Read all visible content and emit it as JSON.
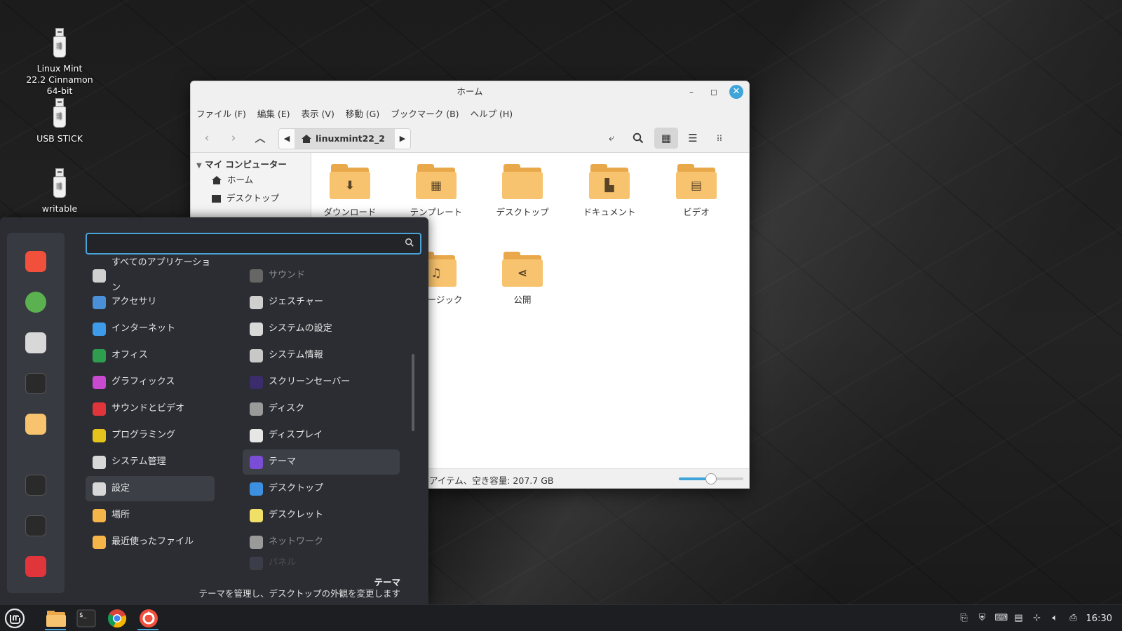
{
  "desktop": {
    "icons": [
      {
        "label": "Linux Mint 22.2 Cinnamon 64-bit"
      },
      {
        "label": "USB STICK"
      },
      {
        "label": "writable"
      }
    ]
  },
  "file_manager": {
    "title": "ホーム",
    "menubar": [
      "ファイル (F)",
      "編集 (E)",
      "表示 (V)",
      "移動 (G)",
      "ブックマーク (B)",
      "ヘルプ (H)"
    ],
    "path": {
      "crumb": "linuxmint22_2"
    },
    "sidebar": {
      "section": "マイ コンピューター",
      "items": [
        "ホーム",
        "デスクトップ"
      ]
    },
    "folders": [
      {
        "label": "ダウンロード",
        "symbol": "⬇"
      },
      {
        "label": "テンプレート",
        "symbol": "▦"
      },
      {
        "label": "デスクトップ",
        "symbol": ""
      },
      {
        "label": "ドキュメント",
        "symbol": "▙"
      },
      {
        "label": "ビデオ",
        "symbol": "▤"
      },
      {
        "label": "ミュージック",
        "symbol": "♫"
      },
      {
        "label": "公開",
        "symbol": "⋖"
      }
    ],
    "status": "アイテム、空き容量: 207.7 GB",
    "zoom_level": 0.5
  },
  "menu": {
    "search": {
      "value": "",
      "placeholder": ""
    },
    "categories": [
      {
        "label": "すべてのアプリケーション",
        "color": "#d0d0d0"
      },
      {
        "label": "アクセサリ",
        "color": "#4a90d9"
      },
      {
        "label": "インターネット",
        "color": "#3d9be9"
      },
      {
        "label": "オフィス",
        "color": "#2e9d4d"
      },
      {
        "label": "グラフィックス",
        "color": "#c84ad0"
      },
      {
        "label": "サウンドとビデオ",
        "color": "#e0353b"
      },
      {
        "label": "プログラミング",
        "color": "#e6c21c"
      },
      {
        "label": "システム管理",
        "color": "#d8d8d8"
      },
      {
        "label": "設定",
        "color": "#d8d8d8"
      },
      {
        "label": "場所",
        "color": "#f5b548"
      },
      {
        "label": "最近使ったファイル",
        "color": "#f5b548"
      }
    ],
    "apps": [
      {
        "label": "サウンド",
        "color": "#666"
      },
      {
        "label": "ジェスチャー",
        "color": "#cfcfcf"
      },
      {
        "label": "システムの設定",
        "color": "#d8d8d8"
      },
      {
        "label": "システム情報",
        "color": "#c8c8c8"
      },
      {
        "label": "スクリーンセーバー",
        "color": "#3b2d6b"
      },
      {
        "label": "ディスク",
        "color": "#9a9a9a"
      },
      {
        "label": "ディスプレイ",
        "color": "#e6e6e6"
      },
      {
        "label": "テーマ",
        "color": "#7a4dd6"
      },
      {
        "label": "デスクトップ",
        "color": "#3d8fe0"
      },
      {
        "label": "デスクレット",
        "color": "#f0e068"
      },
      {
        "label": "ネットワーク",
        "color": "#9a9a9a"
      },
      {
        "label": "パネル",
        "color": "#5a6070"
      }
    ],
    "description": {
      "title": "テーマ",
      "text": "テーマを管理し、デスクトップの外観を変更します"
    },
    "favorites": [
      {
        "name": "firefox",
        "color": "#f0503c"
      },
      {
        "name": "software-manager",
        "color": "#5bb04f"
      },
      {
        "name": "system-settings",
        "color": "#d8d8d8"
      },
      {
        "name": "terminal",
        "color": "#2a2a2a"
      },
      {
        "name": "files",
        "color": "#f7c36e"
      },
      {
        "name": "lock-screen",
        "color": "#2a2a2a"
      },
      {
        "name": "logout",
        "color": "#2a2a2a"
      },
      {
        "name": "shutdown",
        "color": "#e0353b"
      }
    ]
  },
  "taskbar": {
    "clock": "16:30"
  }
}
